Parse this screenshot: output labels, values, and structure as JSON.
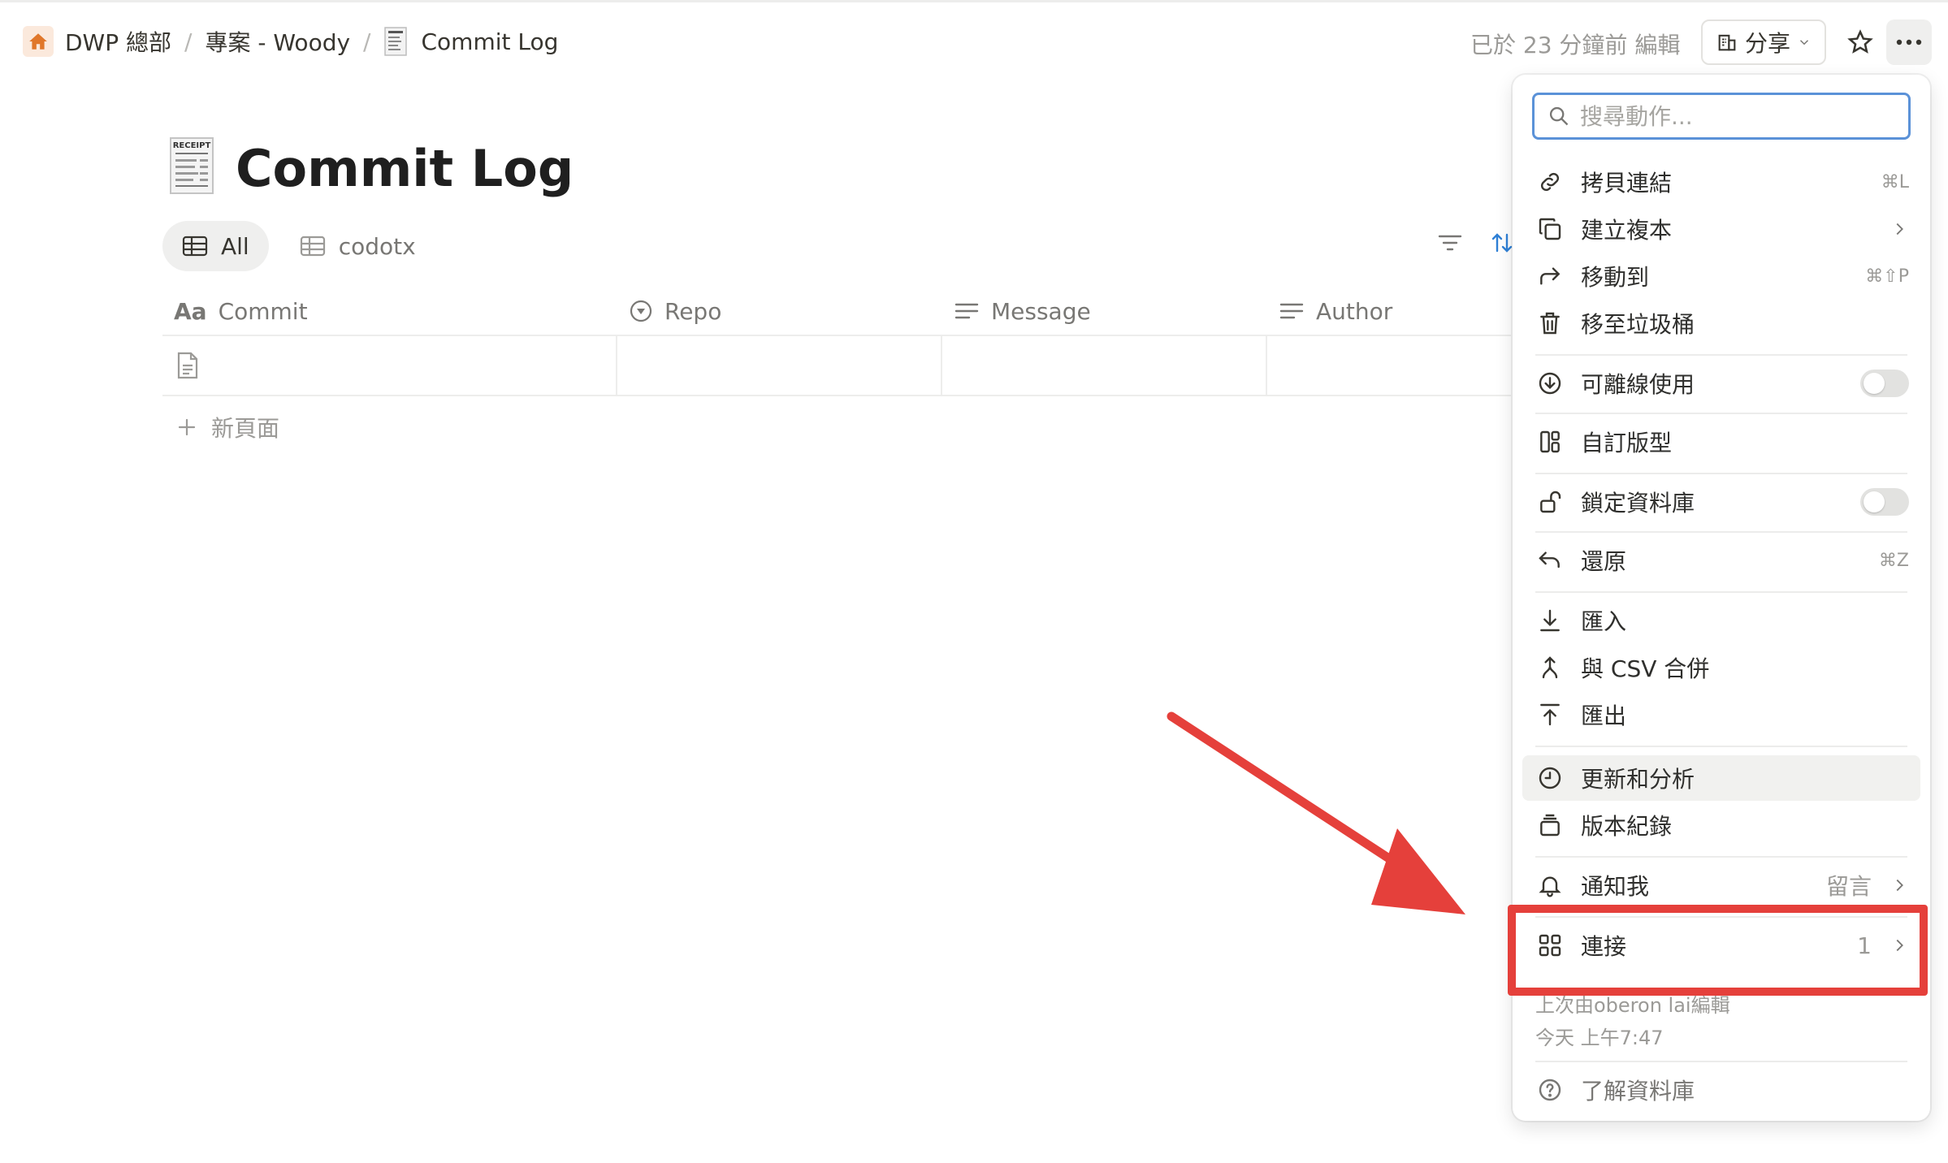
{
  "breadcrumb": {
    "workspace": "DWP 總部",
    "project": "專案 - Woody",
    "page": "Commit Log"
  },
  "header": {
    "edited_text": "已於 23 分鐘前 編輯",
    "share_label": "分享"
  },
  "page": {
    "title": "Commit Log",
    "icon": "receipt-icon",
    "icon_text": "RECEIPT"
  },
  "views": [
    {
      "label": "All",
      "active": true
    },
    {
      "label": "codotx",
      "active": false
    }
  ],
  "table": {
    "columns": [
      {
        "label": "Commit",
        "icon": "text-type-icon"
      },
      {
        "label": "Repo",
        "icon": "select-icon"
      },
      {
        "label": "Message",
        "icon": "lines-icon"
      },
      {
        "label": "Author",
        "icon": "lines-icon"
      }
    ],
    "new_page_label": "新頁面"
  },
  "menu": {
    "search_placeholder": "搜尋動作...",
    "items": [
      {
        "label": "拷貝連結",
        "shortcut": "⌘L",
        "icon": "link-icon"
      },
      {
        "label": "建立複本",
        "icon": "duplicate-icon",
        "has_submenu": true
      },
      {
        "label": "移動到",
        "shortcut": "⌘⇧P",
        "icon": "move-arrow-icon"
      },
      {
        "label": "移至垃圾桶",
        "icon": "trash-icon"
      },
      {
        "label": "可離線使用",
        "icon": "download-circle-icon",
        "toggle": false
      },
      {
        "label": "自訂版型",
        "icon": "layout-icon"
      },
      {
        "label": "鎖定資料庫",
        "icon": "unlock-icon",
        "toggle": false
      },
      {
        "label": "還原",
        "shortcut": "⌘Z",
        "icon": "undo-icon"
      },
      {
        "label": "匯入",
        "icon": "import-icon"
      },
      {
        "label": "與 CSV 合併",
        "icon": "merge-icon"
      },
      {
        "label": "匯出",
        "icon": "export-icon"
      },
      {
        "label": "更新和分析",
        "icon": "clock-icon"
      },
      {
        "label": "版本紀錄",
        "icon": "history-stack-icon"
      },
      {
        "label": "通知我",
        "value": "留言",
        "icon": "bell-icon",
        "has_submenu": true
      },
      {
        "label": "連接",
        "value": "1",
        "icon": "grid-icon",
        "has_submenu": true
      },
      {
        "label": "了解資料庫",
        "icon": "help-circle-icon"
      }
    ],
    "last_edited_by": "上次由oberon lai編輯",
    "last_edited_time": "今天 上午7:47"
  },
  "colors": {
    "accent_blue": "#5b92d8",
    "annotation_red": "#e5403b",
    "home_icon": "#e0772a"
  }
}
